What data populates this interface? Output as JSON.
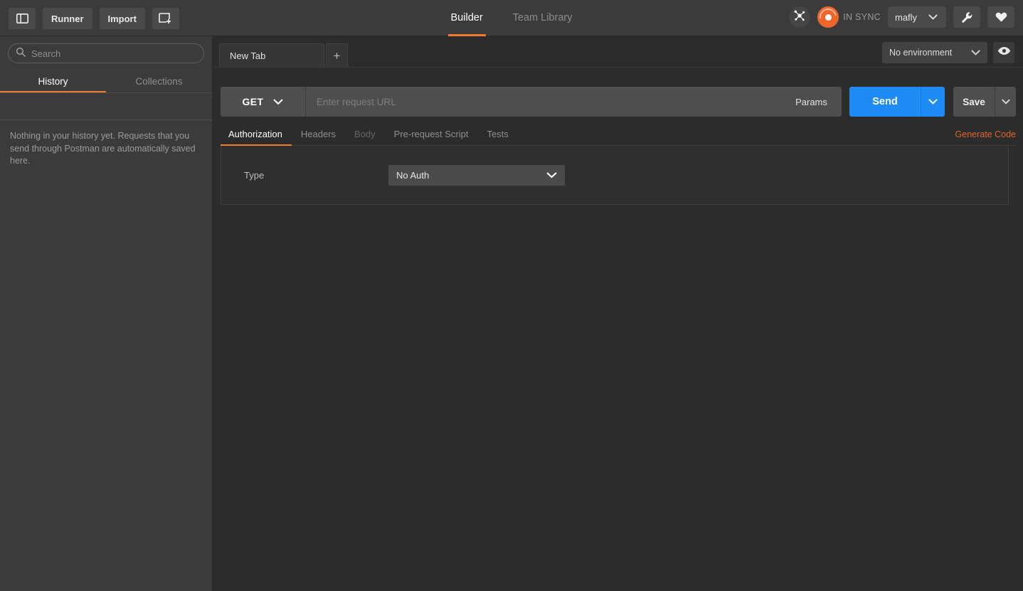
{
  "header": {
    "sidebar_toggle_icon": "panel-toggle-icon",
    "runner_label": "Runner",
    "import_label": "Import",
    "new_window_icon": "new-window-icon",
    "nav_tabs": [
      {
        "label": "Builder",
        "active": true
      },
      {
        "label": "Team Library",
        "active": false
      }
    ],
    "molecule_icon": "molecule-icon",
    "sync_icon": "sync-icon",
    "sync_status": "IN SYNC",
    "user_name": "mafly",
    "user_caret_icon": "chevron-down-icon",
    "wrench_icon": "wrench-icon",
    "heart_icon": "heart-icon"
  },
  "sidebar": {
    "search": {
      "icon": "search-icon",
      "value": "",
      "placeholder": "Search"
    },
    "tabs": [
      {
        "label": "History",
        "active": true
      },
      {
        "label": "Collections",
        "active": false
      }
    ],
    "empty_message": "Nothing in your history yet. Requests that you send through Postman are automatically saved here."
  },
  "main": {
    "request_tabs": [
      {
        "label": "New Tab",
        "active": true
      }
    ],
    "add_tab_label": "+",
    "environment": {
      "selected": "No environment",
      "caret_icon": "chevron-down-icon",
      "eye_icon": "eye-icon"
    },
    "url_bar": {
      "method": "GET",
      "method_caret_icon": "chevron-down-icon",
      "url_value": "",
      "url_placeholder": "Enter request URL",
      "params_label": "Params",
      "send_label": "Send",
      "send_caret_icon": "chevron-down-icon",
      "save_label": "Save",
      "save_caret_icon": "chevron-down-icon"
    },
    "detail_tabs": [
      {
        "label": "Authorization",
        "state": "active"
      },
      {
        "label": "Headers",
        "state": "normal"
      },
      {
        "label": "Body",
        "state": "disabled"
      },
      {
        "label": "Pre-request Script",
        "state": "normal"
      },
      {
        "label": "Tests",
        "state": "normal"
      }
    ],
    "generate_code_label": "Generate Code",
    "authorization": {
      "type_label": "Type",
      "type_value": "No Auth",
      "type_caret_icon": "chevron-down-icon"
    }
  },
  "colors": {
    "accent_orange": "#ef7a30",
    "send_blue": "#1f8cf5",
    "header_bg": "#3b3b3b",
    "main_bg": "#2c2c2c",
    "link_orange": "#e0652b"
  }
}
